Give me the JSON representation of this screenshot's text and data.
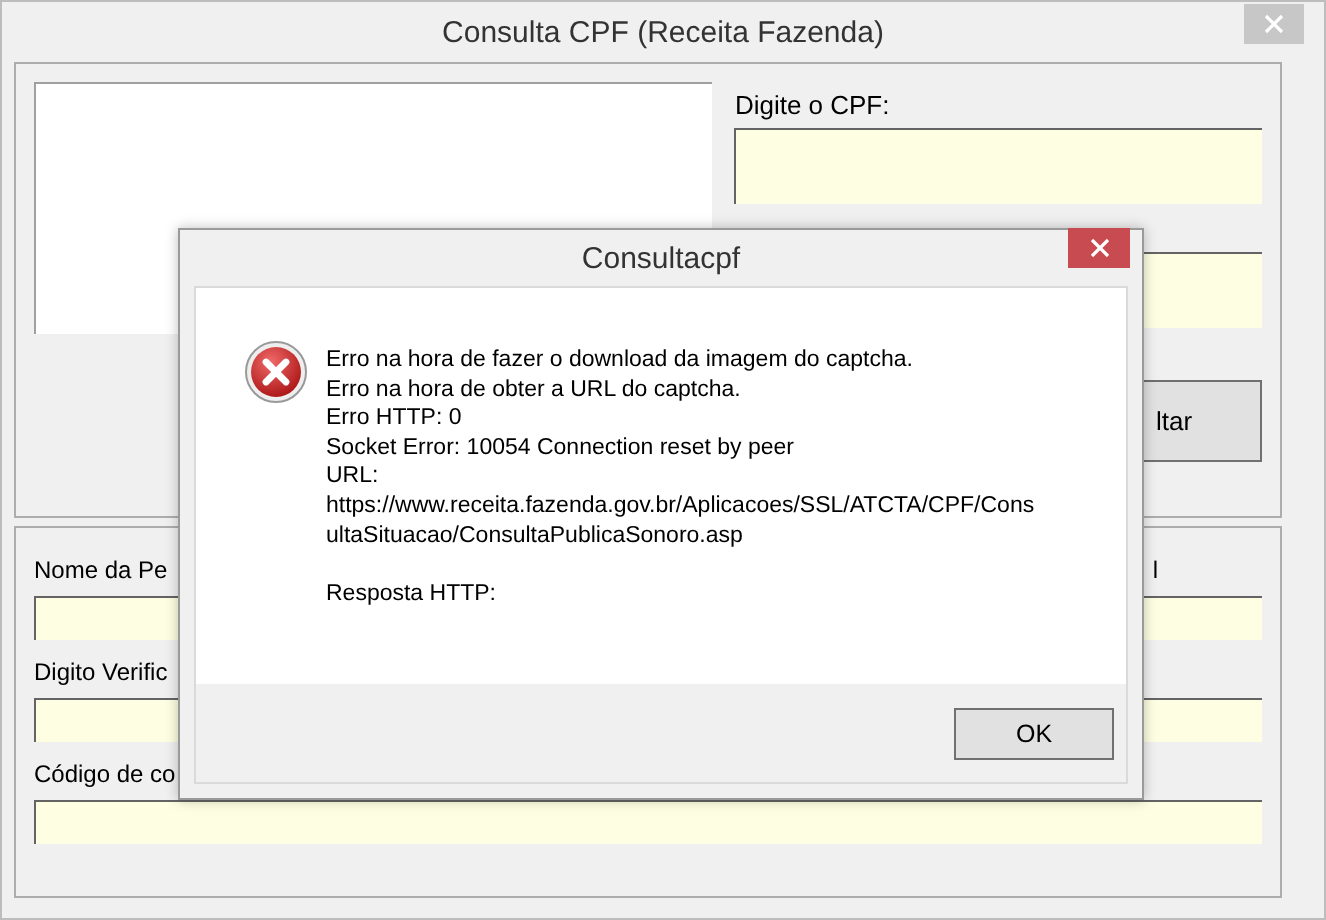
{
  "window": {
    "title": "Consulta CPF (Receita Fazenda)"
  },
  "cpf": {
    "label": "Digite o CPF:"
  },
  "consult_button": {
    "label": "ltar"
  },
  "person_fields": [
    {
      "label": "Nome da Pe",
      "side_label": "l"
    },
    {
      "label": "Digito Verific"
    },
    {
      "label": "Código de co"
    }
  ],
  "dialog": {
    "title": "Consultacpf",
    "kind": "error",
    "lines": [
      "Erro na hora de fazer o download da imagem do captcha.",
      "Erro na hora de obter a URL do captcha.",
      "Erro HTTP: 0",
      "Socket Error: 10054 Connection reset by peer",
      "URL:",
      "https://www.receita.fazenda.gov.br/Aplicacoes/SSL/ATCTA/CPF/Cons",
      "ultaSituacao/ConsultaPublicaSonoro.asp"
    ],
    "response": "Resposta HTTP:",
    "button": "OK"
  }
}
